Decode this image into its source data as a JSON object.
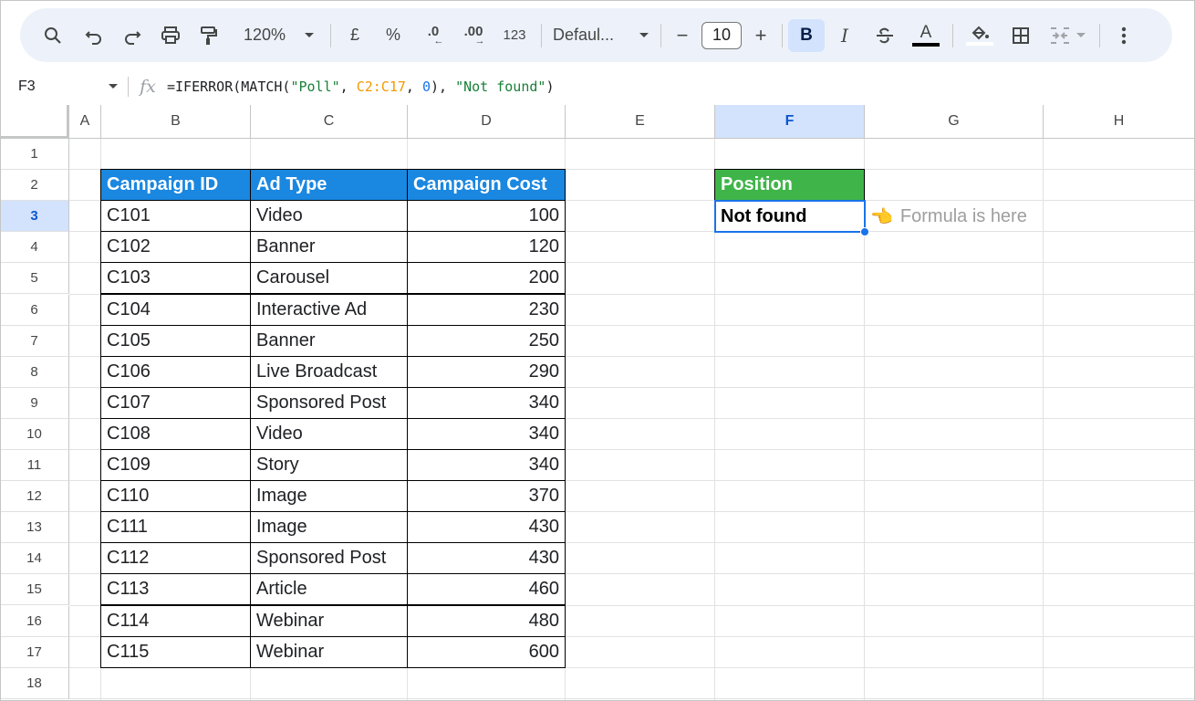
{
  "toolbar": {
    "zoom": "120%",
    "currency": "£",
    "percent": "%",
    "decrease_decimal": ".0",
    "increase_decimal": ".00",
    "number_format": "123",
    "font_name": "Defaul...",
    "font_size": "10",
    "minus": "−",
    "plus": "+",
    "bold": "B",
    "italic": "I",
    "text_color_letter": "A",
    "icons": [
      "search-icon",
      "undo-icon",
      "redo-icon",
      "print-icon",
      "paint-format-icon",
      "chevron-down-icon",
      "strikethrough-icon",
      "fill-color-icon",
      "borders-icon",
      "merge-icon",
      "more-icon"
    ]
  },
  "formula_bar": {
    "cell_ref": "F3",
    "fx": "fx",
    "formula": {
      "p1": "=IFERROR(MATCH(",
      "s1": "\"Poll\"",
      "p2": ", ",
      "range": "C2:C17",
      "p3": ", ",
      "num": "0",
      "p4": "), ",
      "s2": "\"Not found\"",
      "p5": ")"
    }
  },
  "columns": [
    "A",
    "B",
    "C",
    "D",
    "E",
    "F",
    "G",
    "H"
  ],
  "rows": [
    "1",
    "2",
    "3",
    "4",
    "5",
    "6",
    "7",
    "8",
    "9",
    "10",
    "11",
    "12",
    "13",
    "14",
    "15",
    "16",
    "17",
    "18"
  ],
  "table": {
    "headers": [
      "Campaign ID",
      "Ad Type",
      "Campaign Cost"
    ],
    "rows": [
      [
        "C101",
        "Video",
        "100"
      ],
      [
        "C102",
        "Banner",
        "120"
      ],
      [
        "C103",
        "Carousel",
        "200"
      ],
      [
        "C104",
        "Interactive Ad",
        "230"
      ],
      [
        "C105",
        "Banner",
        "250"
      ],
      [
        "C106",
        "Live Broadcast",
        "290"
      ],
      [
        "C107",
        "Sponsored Post",
        "340"
      ],
      [
        "C108",
        "Video",
        "340"
      ],
      [
        "C109",
        "Story",
        "340"
      ],
      [
        "C110",
        "Image",
        "370"
      ],
      [
        "C111",
        "Image",
        "430"
      ],
      [
        "C112",
        "Sponsored Post",
        "430"
      ],
      [
        "C113",
        "Article",
        "460"
      ],
      [
        "C114",
        "Webinar",
        "480"
      ],
      [
        "C115",
        "Webinar",
        "600"
      ]
    ]
  },
  "result": {
    "header": "Position",
    "value": "Not found",
    "note_icon": "👈",
    "note": "Formula is here"
  },
  "colors": {
    "table_header": "#1a87e0",
    "result_header": "#3fb549",
    "selection": "#1a73e8"
  }
}
